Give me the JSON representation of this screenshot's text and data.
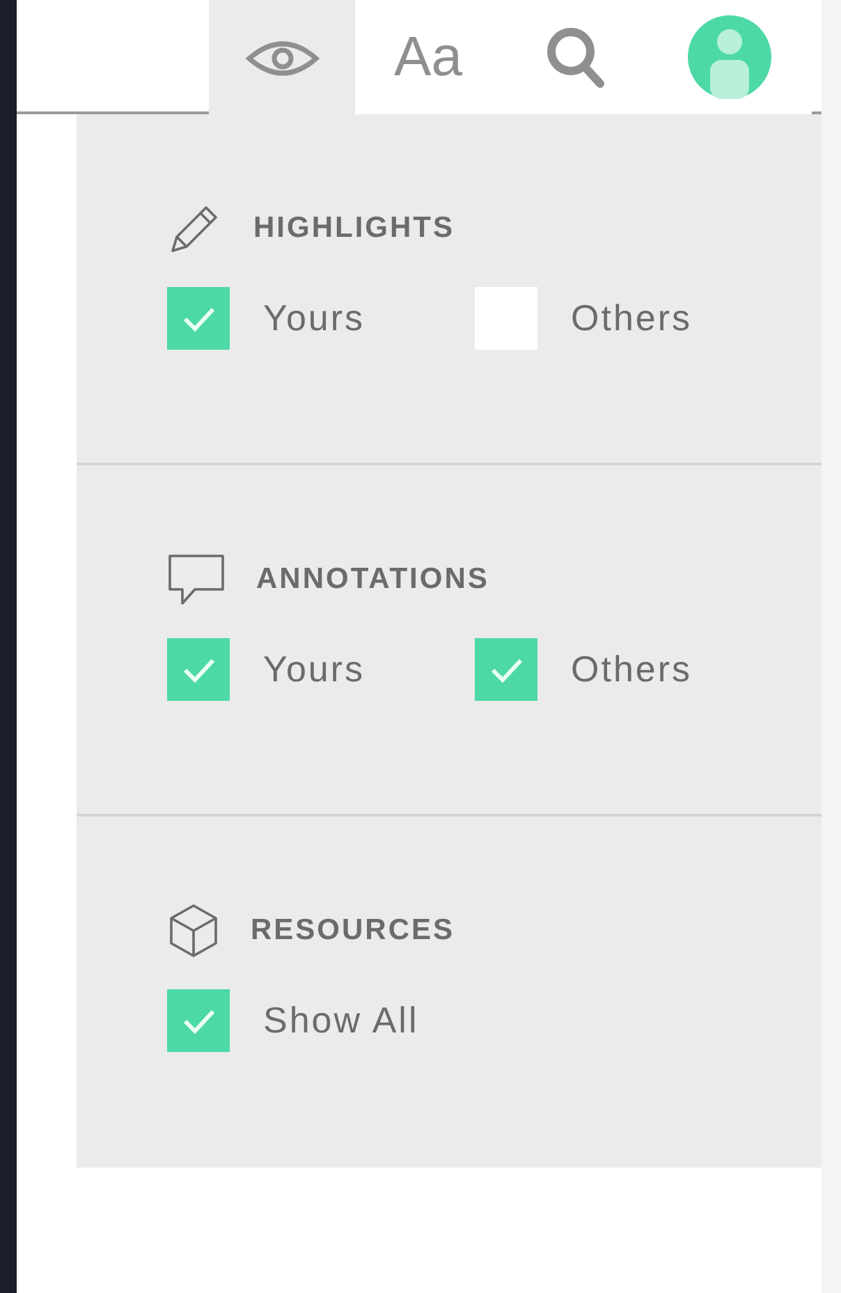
{
  "toolbar": {
    "tabs": [
      {
        "kind": "view",
        "selected": true
      },
      {
        "kind": "text",
        "label": "Aa",
        "selected": false
      },
      {
        "kind": "search",
        "selected": false
      },
      {
        "kind": "account",
        "selected": false
      }
    ]
  },
  "sections": [
    {
      "kind": "pencil",
      "title": "HIGHLIGHTS",
      "options": [
        {
          "label": "Yours",
          "checked": true
        },
        {
          "label": "Others",
          "checked": false
        }
      ]
    },
    {
      "kind": "comment",
      "title": "ANNOTATIONS",
      "options": [
        {
          "label": "Yours",
          "checked": true
        },
        {
          "label": "Others",
          "checked": true
        }
      ]
    },
    {
      "kind": "cube",
      "title": "RESOURCES",
      "options": [
        {
          "label": "Show All",
          "checked": true
        }
      ]
    }
  ]
}
